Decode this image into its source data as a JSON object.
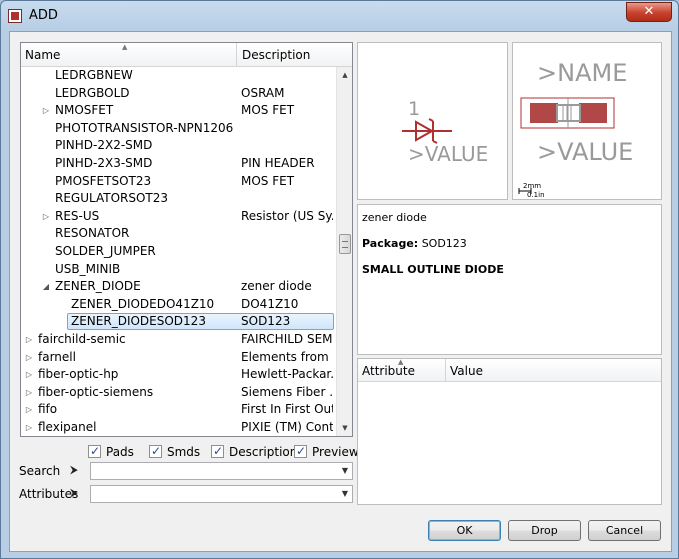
{
  "window": {
    "title": "ADD",
    "close_label": "✕"
  },
  "tree": {
    "columns": {
      "name": "Name",
      "description": "Description"
    },
    "rows": [
      {
        "name": "LEDRGBNEW",
        "desc": "",
        "level": 2,
        "expander": ""
      },
      {
        "name": "LEDRGBOLD",
        "desc": "OSRAM",
        "level": 2,
        "expander": ""
      },
      {
        "name": "NMOSFET",
        "desc": "MOS FET",
        "level": 2,
        "expander": "▷"
      },
      {
        "name": "PHOTOTRANSISTOR-NPN1206",
        "desc": "",
        "level": 2,
        "expander": ""
      },
      {
        "name": "PINHD-2X2-SMD",
        "desc": "",
        "level": 2,
        "expander": ""
      },
      {
        "name": "PINHD-2X3-SMD",
        "desc": "PIN HEADER",
        "level": 2,
        "expander": ""
      },
      {
        "name": "PMOSFETSOT23",
        "desc": "MOS FET",
        "level": 2,
        "expander": ""
      },
      {
        "name": "REGULATORSOT23",
        "desc": "",
        "level": 2,
        "expander": ""
      },
      {
        "name": "RES-US",
        "desc": "Resistor (US Sy...",
        "level": 2,
        "expander": "▷"
      },
      {
        "name": "RESONATOR",
        "desc": "",
        "level": 2,
        "expander": ""
      },
      {
        "name": "SOLDER_JUMPER",
        "desc": "",
        "level": 2,
        "expander": ""
      },
      {
        "name": "USB_MINIB",
        "desc": "",
        "level": 2,
        "expander": ""
      },
      {
        "name": "ZENER_DIODE",
        "desc": "zener diode",
        "level": 2,
        "expander": "◢"
      },
      {
        "name": "ZENER_DIODEDO41Z10",
        "desc": "DO41Z10",
        "level": 3,
        "expander": ""
      },
      {
        "name": "ZENER_DIODESOD123",
        "desc": "SOD123",
        "level": 3,
        "expander": "",
        "selected": true
      },
      {
        "name": "fairchild-semic",
        "desc": "FAIRCHILD SEM...",
        "level": 1,
        "expander": "▷"
      },
      {
        "name": "farnell",
        "desc": "Elements from ...",
        "level": 1,
        "expander": "▷"
      },
      {
        "name": "fiber-optic-hp",
        "desc": "Hewlett-Packar...",
        "level": 1,
        "expander": "▷"
      },
      {
        "name": "fiber-optic-siemens",
        "desc": "Siemens Fiber ...",
        "level": 1,
        "expander": "▷"
      },
      {
        "name": "fifo",
        "desc": "First In First Out...",
        "level": 1,
        "expander": "▷"
      },
      {
        "name": "flexipanel",
        "desc": "PIXIE (TM) Cont...",
        "level": 1,
        "expander": "▷"
      }
    ]
  },
  "filters": {
    "pads": "Pads",
    "smds": "Smds",
    "description": "Description",
    "preview": "Preview",
    "pads_checked": true,
    "smds_checked": true,
    "description_checked": true,
    "preview_checked": true
  },
  "search": {
    "label": "Search",
    "value": ""
  },
  "attributes_filter": {
    "label": "Attributes",
    "value": ""
  },
  "symbol_preview": {
    "pin_number": "1",
    "value_text": ">VALUE",
    "color": "#b03030"
  },
  "package_preview": {
    "name_text": ">NAME",
    "value_text": ">VALUE",
    "scale_mm": "2mm",
    "scale_in": "0.1in"
  },
  "details": {
    "title": "zener diode",
    "package_label": "Package:",
    "package_value": "SOD123",
    "long_desc": "SMALL OUTLINE DIODE"
  },
  "attribute_table": {
    "col_attribute": "Attribute",
    "col_value": "Value"
  },
  "buttons": {
    "ok": "OK",
    "drop": "Drop",
    "cancel": "Cancel"
  }
}
